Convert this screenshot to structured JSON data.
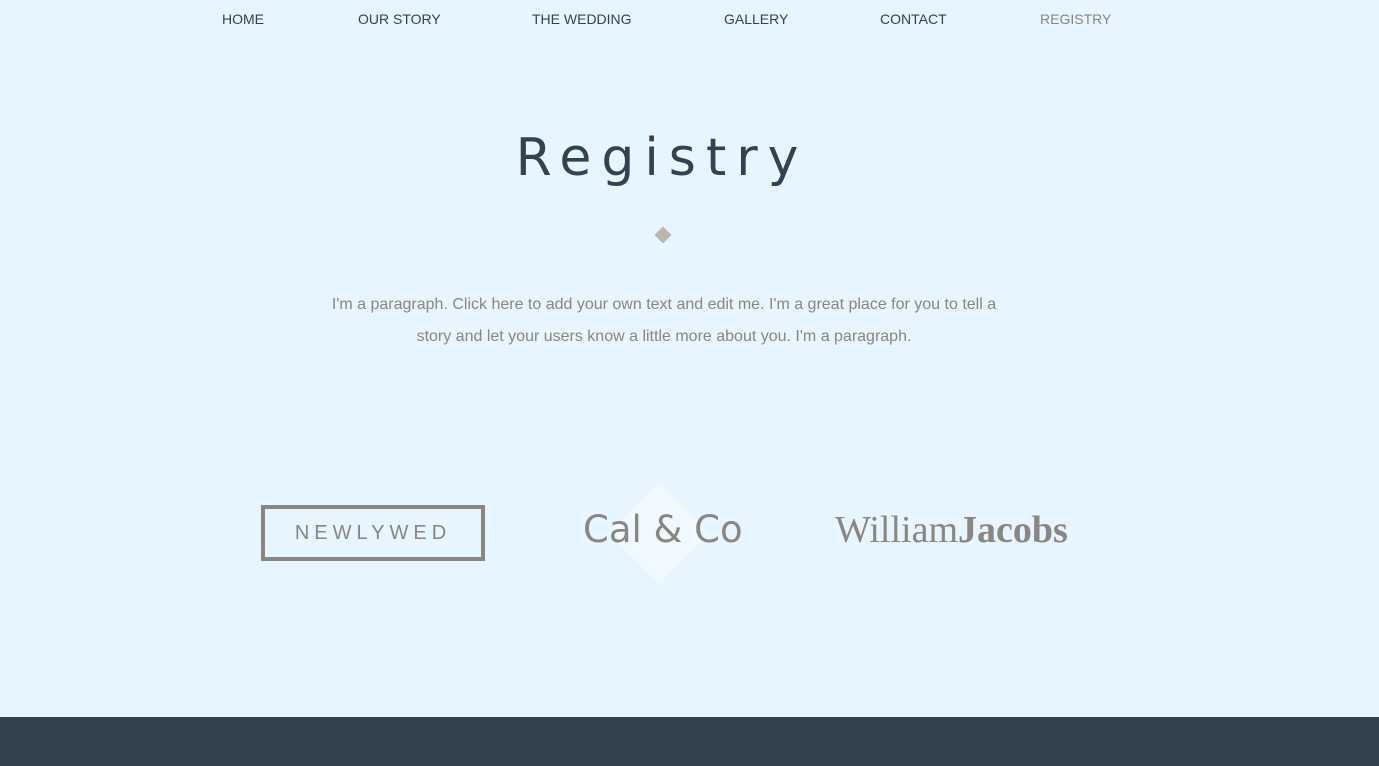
{
  "nav": {
    "items": [
      {
        "label": "HOME"
      },
      {
        "label": "OUR STORY"
      },
      {
        "label": "THE WEDDING"
      },
      {
        "label": "GALLERY"
      },
      {
        "label": "CONTACT"
      },
      {
        "label": "REGISTRY"
      }
    ],
    "active": "REGISTRY"
  },
  "page": {
    "title": "Registry",
    "paragraph": "I'm a paragraph. Click here to add your own text and edit me. I'm a great place for you to tell a story and let your users know a little more about you. I'm a paragraph."
  },
  "registries": {
    "newlywed": "NEWLYWED",
    "cal_co": "Cal & Co",
    "william": "William",
    "jacobs": "Jacobs"
  },
  "colors": {
    "background": "#e6f5ff",
    "text_dark": "#34424f",
    "text_muted": "#8a8680",
    "footer": "#34424f"
  }
}
